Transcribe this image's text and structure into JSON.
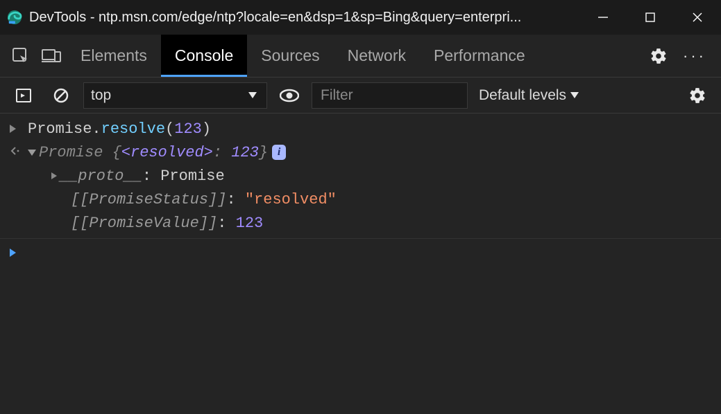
{
  "window": {
    "title": "DevTools - ntp.msn.com/edge/ntp?locale=en&dsp=1&sp=Bing&query=enterpri..."
  },
  "tabs": {
    "elements": "Elements",
    "console": "Console",
    "sources": "Sources",
    "network": "Network",
    "performance": "Performance"
  },
  "toolbar": {
    "context": "top",
    "filter_placeholder": "Filter",
    "levels": "Default levels"
  },
  "console": {
    "input_line": {
      "object": "Promise",
      "dot": ".",
      "method": "resolve",
      "open": "(",
      "arg": "123",
      "close": ")"
    },
    "output": {
      "result_prefix_typename": "Promise ",
      "brace_open": "{",
      "resolved_key": "<resolved>",
      "colon": ": ",
      "resolved_val": "123",
      "brace_close": "}",
      "info_char": "i",
      "proto_key": "__proto__",
      "proto_colon": ": ",
      "proto_val": "Promise",
      "status_key": "[[PromiseStatus]]",
      "status_colon": ": ",
      "status_val": "\"resolved\"",
      "value_key": "[[PromiseValue]]",
      "value_colon": ": ",
      "value_val": "123"
    }
  }
}
